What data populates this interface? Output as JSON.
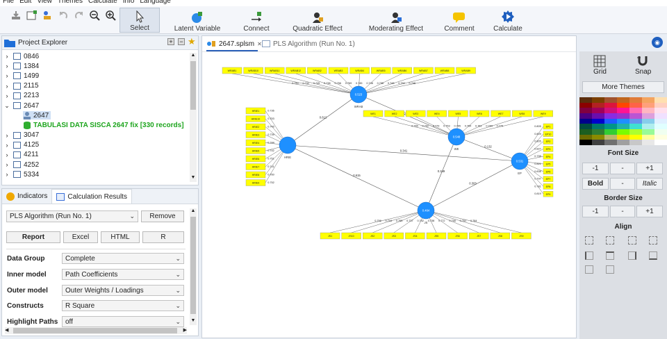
{
  "menu": [
    "File",
    "Edit",
    "View",
    "Themes",
    "Calculate",
    "Info",
    "Language"
  ],
  "toolbar": {
    "select": "Select",
    "latent_variable": "Latent Variable",
    "connect": "Connect",
    "quadratic_effect": "Quadratic Effect",
    "moderating_effect": "Moderating Effect",
    "comment": "Comment",
    "calculate": "Calculate"
  },
  "explorer": {
    "title": "Project Explorer",
    "items": [
      "0846",
      "1384",
      "1499",
      "2115",
      "2213",
      "2647",
      "2647",
      "TABULASI DATA SISCA 2647 fix [330 records]",
      "3047",
      "4125",
      "4211",
      "4252",
      "5334"
    ]
  },
  "calc": {
    "tab_indicators": "Indicators",
    "tab_results": "Calculation Results",
    "run": "PLS Algorithm (Run No. 1)",
    "remove": "Remove",
    "report": "Report",
    "excel": "Excel",
    "html": "HTML",
    "r": "R",
    "labels": {
      "data_group": "Data Group",
      "inner_model": "Inner model",
      "outer_model": "Outer model",
      "constructs": "Constructs",
      "highlight_paths": "Highlight Paths"
    },
    "values": {
      "data_group": "Complete",
      "inner_model": "Path Coefficients",
      "outer_model": "Outer Weights / Loadings",
      "constructs": "R Square",
      "highlight_paths": "off"
    }
  },
  "editor": {
    "tab1": "2647.splsm",
    "tab2": "PLS Algorithm (Run No. 1)"
  },
  "model": {
    "constructs": {
      "MA": {
        "label": "WRAB",
        "value": "0.523"
      },
      "HR": {
        "label": "HRIE",
        "value": ""
      },
      "WE": {
        "label": "WE",
        "value": "0.548"
      },
      "EP": {
        "label": "EP",
        "value": "0.531"
      },
      "JS": {
        "label": "JS",
        "value": "0.464"
      }
    },
    "paths": {
      "HR_MA": "0.612",
      "MA_WE": "0.549",
      "HR_EP": "0.341",
      "WE_EP": "0.132",
      "WE_JS": "0.349",
      "HR_JS": "0.615",
      "EP_JS": "0.303"
    },
    "ma_indicators": [
      "WRAB1",
      "WRAB10",
      "WRAB11",
      "WRAB12",
      "WRAB2",
      "WRAB3",
      "WRAB4",
      "WRAB5",
      "WRAB6",
      "WRAB7",
      "WRAB8",
      "WRAB9"
    ],
    "ma_loadings": [
      "0.750",
      "0.741",
      "0.745",
      "0.738",
      "0.756",
      "0.769",
      "0.745",
      "0.746",
      "0.736",
      "0.746",
      "0.750",
      "0.748"
    ],
    "hr_indicators": [
      "HRIE1",
      "HRIE10",
      "HRIE2",
      "HRIE3",
      "HRIE4",
      "HRIE5",
      "HRIE6",
      "HRIE7",
      "HRIE8",
      "HRIE9"
    ],
    "hr_loadings": [
      "0.736",
      "0.753",
      "0.745",
      "0.739",
      "0.744",
      "0.742",
      "0.751",
      "0.741",
      "0.760",
      "0.752"
    ],
    "we_indicators": [
      "WE1",
      "WE2",
      "WE3",
      "WE4",
      "WE5",
      "WE6",
      "WE7",
      "WE8",
      "WE9"
    ],
    "we_loadings": [
      "0.755",
      "0.792",
      "0.779",
      "0.753",
      "0.765",
      "0.764",
      "0.761",
      "0.784",
      "0.770"
    ],
    "ep_indicators": [
      "EP1",
      "EP10",
      "EP2",
      "EP3",
      "EP4",
      "EP5",
      "EP6",
      "EP7",
      "EP8",
      "EP9"
    ],
    "ep_loadings": [
      "0.805",
      "0.809",
      "0.805",
      "0.827",
      "0.798",
      "0.821",
      "0.838",
      "0.797",
      "0.781",
      "0.819"
    ],
    "js_indicators": [
      "JS1",
      "JS10",
      "JS2",
      "JS3",
      "JS4",
      "JS5",
      "JS6",
      "JS7",
      "JS8",
      "JS9"
    ],
    "js_loadings": [
      "0.756",
      "0.744",
      "0.765",
      "0.737",
      "0.742",
      "0.738",
      "0.772",
      "0.758",
      "0.761",
      "0.784"
    ]
  },
  "right_panel": {
    "grid": "Grid",
    "snap": "Snap",
    "more_themes": "More Themes",
    "font_size": "Font Size",
    "minus": "-1",
    "dash": "-",
    "plus": "+1",
    "bold": "Bold",
    "italic": "Italic",
    "border_size": "Border Size",
    "align": "Align",
    "swatches": [
      "#5a2d0c",
      "#7b3f00",
      "#a0522d",
      "#c0661e",
      "#e07b39",
      "#f4a460",
      "#ffe0b0",
      "#8b0000",
      "#b22222",
      "#dc143c",
      "#ff4500",
      "#ff6347",
      "#ffa07a",
      "#ffd0c0",
      "#800040",
      "#a0005a",
      "#d0107a",
      "#ff1493",
      "#ff69b4",
      "#ffb6c1",
      "#ffe0ee",
      "#4b0082",
      "#6a0dad",
      "#8a2be2",
      "#9932cc",
      "#ba55d3",
      "#dda0dd",
      "#f0e0ff",
      "#00008b",
      "#0000cd",
      "#1e5bff",
      "#1e90ff",
      "#6495ed",
      "#87ceeb",
      "#e0f0ff",
      "#004d40",
      "#00796b",
      "#009688",
      "#20b2aa",
      "#40e0d0",
      "#afeeee",
      "#e0ffff",
      "#1b5e20",
      "#2e7d32",
      "#32cd32",
      "#7cfc00",
      "#adff2f",
      "#98fb98",
      "#f0fff0",
      "#6b6b00",
      "#8b8b00",
      "#bdb76b",
      "#ffd700",
      "#ffff00",
      "#ffff99",
      "#ffffe0",
      "#000000",
      "#404040",
      "#707070",
      "#a0a0a0",
      "#c8c8c8",
      "#e8e8e8",
      "#ffffff"
    ]
  }
}
